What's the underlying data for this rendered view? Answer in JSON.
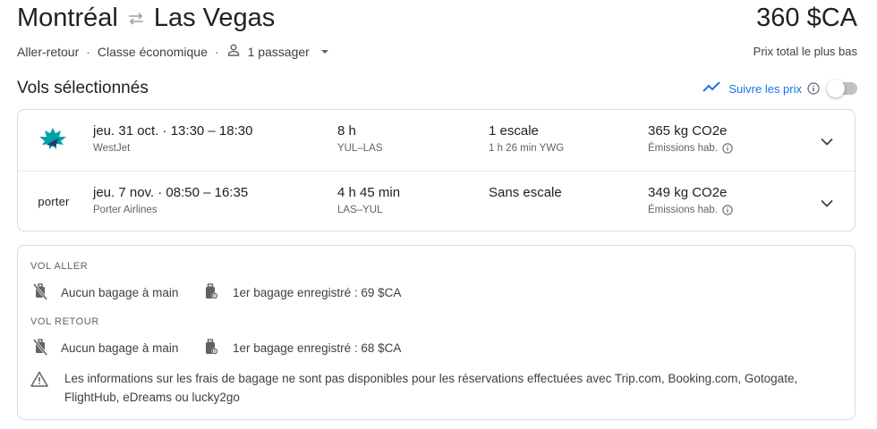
{
  "header": {
    "origin": "Montréal",
    "destination": "Las Vegas",
    "price": "360 $CA",
    "trip_type": "Aller-retour",
    "cabin": "Classe économique",
    "passengers": "1 passager",
    "price_note": "Prix total le plus bas"
  },
  "selected": {
    "title": "Vols sélectionnés",
    "track_label": "Suivre les prix",
    "track_enabled": false
  },
  "flights": [
    {
      "logo": "westjet-logo",
      "times": "jeu. 31 oct.  ·  13:30 – 18:30",
      "airline": "WestJet",
      "duration": "8 h",
      "airports": "YUL–LAS",
      "stops": "1 escale",
      "layover": "1 h 26 min YWG",
      "emissions": "365 kg CO2e",
      "emissions_note": "Émissions hab."
    },
    {
      "logo_text": "porter",
      "times": "jeu. 7 nov.  ·  08:50 – 16:35",
      "airline": "Porter Airlines",
      "duration": "4 h 45 min",
      "airports": "LAS–YUL",
      "stops": "Sans escale",
      "layover": "",
      "emissions": "349 kg CO2e",
      "emissions_note": "Émissions hab."
    }
  ],
  "baggage": {
    "outbound_title": "VOL ALLER",
    "outbound_carryon": "Aucun bagage à main",
    "outbound_checked": "1er bagage enregistré : 69 $CA",
    "return_title": "VOL RETOUR",
    "return_carryon": "Aucun bagage à main",
    "return_checked": "1er bagage enregistré : 68 $CA",
    "warning": "Les informations sur les frais de bagage ne sont pas disponibles pour les réservations effectuées avec Trip.com, Booking.com, Gotogate, FlightHub, eDreams ou lucky2go"
  },
  "colors": {
    "accent": "#1a73e8",
    "text": "#202124",
    "secondary": "#5f6368",
    "border": "#dadce0",
    "westjet": "#00a3ad"
  }
}
